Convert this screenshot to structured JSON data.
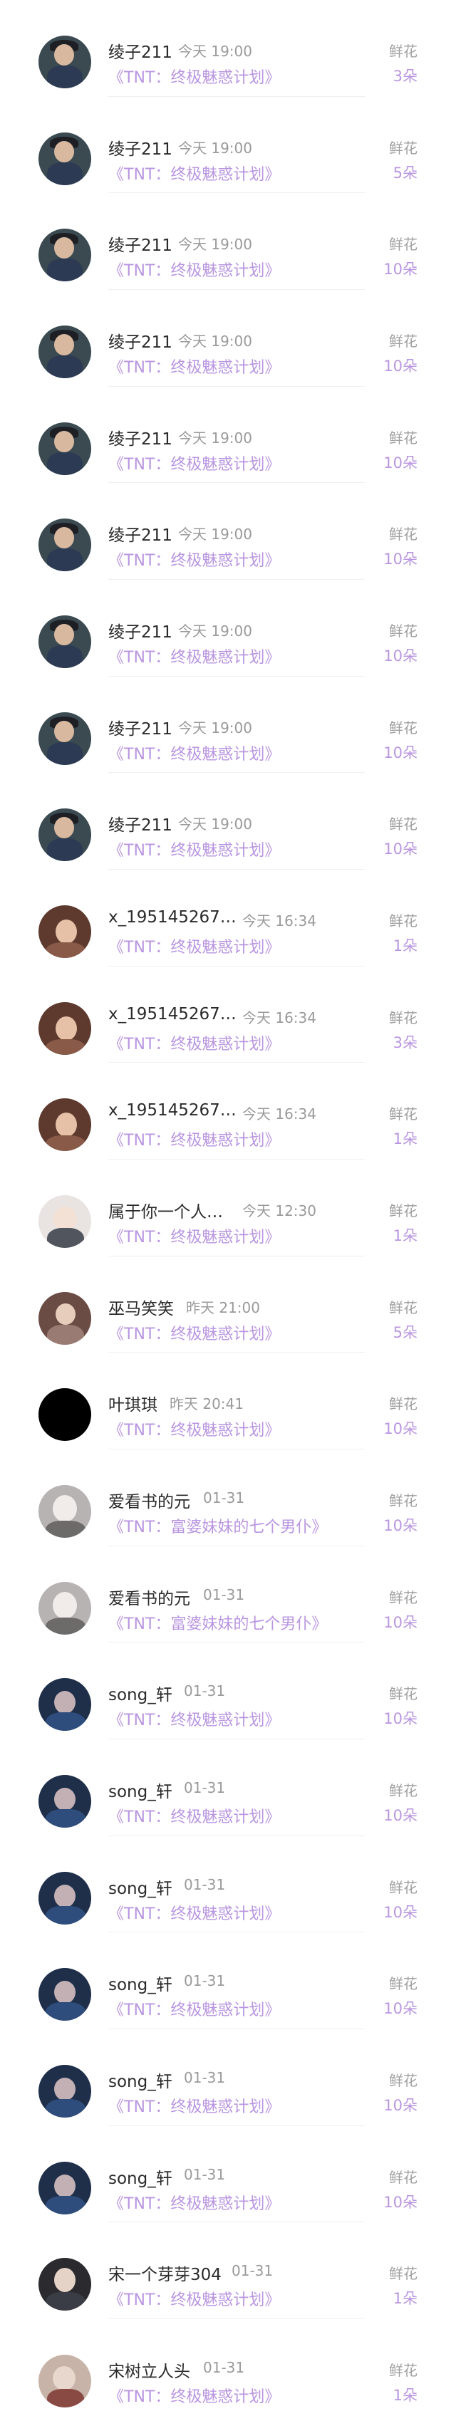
{
  "gift_list": {
    "items": [
      {
        "name": "绫子211",
        "time": "今天 19:00",
        "book": "《TNT：终极魅惑计划》",
        "gift_type": "鲜花",
        "count": "3朵",
        "avatar": "avatar-dark"
      },
      {
        "name": "绫子211",
        "time": "今天 19:00",
        "book": "《TNT：终极魅惑计划》",
        "gift_type": "鲜花",
        "count": "5朵",
        "avatar": "avatar-dark"
      },
      {
        "name": "绫子211",
        "time": "今天 19:00",
        "book": "《TNT：终极魅惑计划》",
        "gift_type": "鲜花",
        "count": "10朵",
        "avatar": "avatar-dark"
      },
      {
        "name": "绫子211",
        "time": "今天 19:00",
        "book": "《TNT：终极魅惑计划》",
        "gift_type": "鲜花",
        "count": "10朵",
        "avatar": "avatar-dark"
      },
      {
        "name": "绫子211",
        "time": "今天 19:00",
        "book": "《TNT：终极魅惑计划》",
        "gift_type": "鲜花",
        "count": "10朵",
        "avatar": "avatar-dark"
      },
      {
        "name": "绫子211",
        "time": "今天 19:00",
        "book": "《TNT：终极魅惑计划》",
        "gift_type": "鲜花",
        "count": "10朵",
        "avatar": "avatar-dark"
      },
      {
        "name": "绫子211",
        "time": "今天 19:00",
        "book": "《TNT：终极魅惑计划》",
        "gift_type": "鲜花",
        "count": "10朵",
        "avatar": "avatar-dark"
      },
      {
        "name": "绫子211",
        "time": "今天 19:00",
        "book": "《TNT：终极魅惑计划》",
        "gift_type": "鲜花",
        "count": "10朵",
        "avatar": "avatar-dark"
      },
      {
        "name": "绫子211",
        "time": "今天 19:00",
        "book": "《TNT：终极魅惑计划》",
        "gift_type": "鲜花",
        "count": "10朵",
        "avatar": "avatar-dark"
      },
      {
        "name": "x_195145267…",
        "time": "今天 16:34",
        "book": "《TNT：终极魅惑计划》",
        "gift_type": "鲜花",
        "count": "1朵",
        "avatar": "avatar-girl"
      },
      {
        "name": "x_195145267…",
        "time": "今天 16:34",
        "book": "《TNT：终极魅惑计划》",
        "gift_type": "鲜花",
        "count": "3朵",
        "avatar": "avatar-girl"
      },
      {
        "name": "x_195145267…",
        "time": "今天 16:34",
        "book": "《TNT：终极魅惑计划》",
        "gift_type": "鲜花",
        "count": "1朵",
        "avatar": "avatar-girl"
      },
      {
        "name": "属于你一个人…",
        "time": "今天 12:30",
        "book": "《TNT：终极魅惑计划》",
        "gift_type": "鲜花",
        "count": "1朵",
        "avatar": "avatar-shu"
      },
      {
        "name": "巫马笑笑",
        "time": "昨天 21:00",
        "book": "《TNT：终极魅惑计划》",
        "gift_type": "鲜花",
        "count": "5朵",
        "avatar": "avatar-wu"
      },
      {
        "name": "叶琪琪",
        "time": "昨天 20:41",
        "book": "《TNT：终极魅惑计划》",
        "gift_type": "鲜花",
        "count": "10朵",
        "avatar": "avatar-black"
      },
      {
        "name": "爱看书的元",
        "time": "01-31",
        "book": "《TNT：富婆妹妹的七个男仆》",
        "gift_type": "鲜花",
        "count": "10朵",
        "avatar": "avatar-mask"
      },
      {
        "name": "爱看书的元",
        "time": "01-31",
        "book": "《TNT：富婆妹妹的七个男仆》",
        "gift_type": "鲜花",
        "count": "10朵",
        "avatar": "avatar-mask"
      },
      {
        "name": "song_轩",
        "time": "01-31",
        "book": "《TNT：终极魅惑计划》",
        "gift_type": "鲜花",
        "count": "10朵",
        "avatar": "avatar-song"
      },
      {
        "name": "song_轩",
        "time": "01-31",
        "book": "《TNT：终极魅惑计划》",
        "gift_type": "鲜花",
        "count": "10朵",
        "avatar": "avatar-song"
      },
      {
        "name": "song_轩",
        "time": "01-31",
        "book": "《TNT：终极魅惑计划》",
        "gift_type": "鲜花",
        "count": "10朵",
        "avatar": "avatar-song"
      },
      {
        "name": "song_轩",
        "time": "01-31",
        "book": "《TNT：终极魅惑计划》",
        "gift_type": "鲜花",
        "count": "10朵",
        "avatar": "avatar-song"
      },
      {
        "name": "song_轩",
        "time": "01-31",
        "book": "《TNT：终极魅惑计划》",
        "gift_type": "鲜花",
        "count": "10朵",
        "avatar": "avatar-song"
      },
      {
        "name": "song_轩",
        "time": "01-31",
        "book": "《TNT：终极魅惑计划》",
        "gift_type": "鲜花",
        "count": "10朵",
        "avatar": "avatar-song"
      },
      {
        "name": "宋一个芽芽304",
        "time": "01-31",
        "book": "《TNT：终极魅惑计划》",
        "gift_type": "鲜花",
        "count": "1朵",
        "avatar": "avatar-song2"
      },
      {
        "name": "宋树立人头",
        "time": "01-31",
        "book": "《TNT：终极魅惑计划》",
        "gift_type": "鲜花",
        "count": "1朵",
        "avatar": "avatar-shut"
      }
    ]
  },
  "colors": {
    "accent_purple": "#b996e0",
    "name_text": "#2b2b2b",
    "muted_text": "#9a9a9a",
    "divider": "#efefef"
  }
}
